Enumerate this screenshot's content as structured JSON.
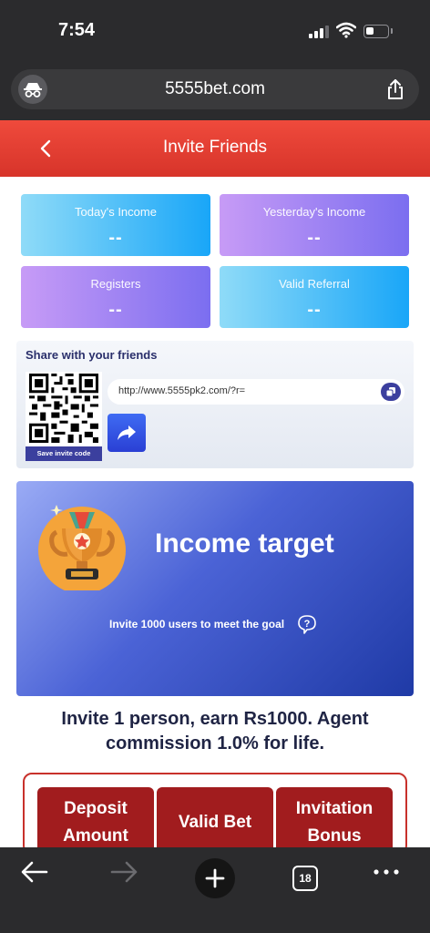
{
  "status_bar": {
    "time": "7:54"
  },
  "browser": {
    "url": "5555bet.com",
    "tab_count": "18"
  },
  "header": {
    "title": "Invite Friends"
  },
  "stats": {
    "today_income": {
      "label": "Today's Income",
      "value": "--"
    },
    "yesterday_income": {
      "label": "Yesterday's Income",
      "value": "--"
    },
    "registers": {
      "label": "Registers",
      "value": "--"
    },
    "valid_referral": {
      "label": "Valid Referral",
      "value": "--"
    }
  },
  "share": {
    "title": "Share with your friends",
    "link": "http://www.5555pk2.com/?r=",
    "save_code_label": "Save invite code"
  },
  "target": {
    "title": "Income target",
    "subtitle": "Invite 1000 users to meet the goal"
  },
  "invite_text_line1": "Invite 1 person, earn Rs1000. Agent",
  "invite_text_line2": "commission 1.0% for life.",
  "table": {
    "headers": [
      "Deposit Amount",
      "Valid Bet",
      "Invitation Bonus"
    ],
    "header_lines": [
      [
        "Deposit",
        "Amount"
      ],
      [
        "Valid Bet"
      ],
      [
        "Invitation",
        "Bonus"
      ]
    ]
  },
  "colors": {
    "header_red": "#e13f33",
    "card_blue": "#19a6f8",
    "card_purple": "#7b6ef0",
    "accent_indigo": "#3b3f9e",
    "table_red": "#a11c1e"
  },
  "icons": [
    "incognito-icon",
    "share-icon",
    "back-icon",
    "copy-icon",
    "share-arrow-icon",
    "trophy-icon",
    "help-icon",
    "arrow-left-icon",
    "arrow-right-icon",
    "plus-icon",
    "more-icon"
  ]
}
